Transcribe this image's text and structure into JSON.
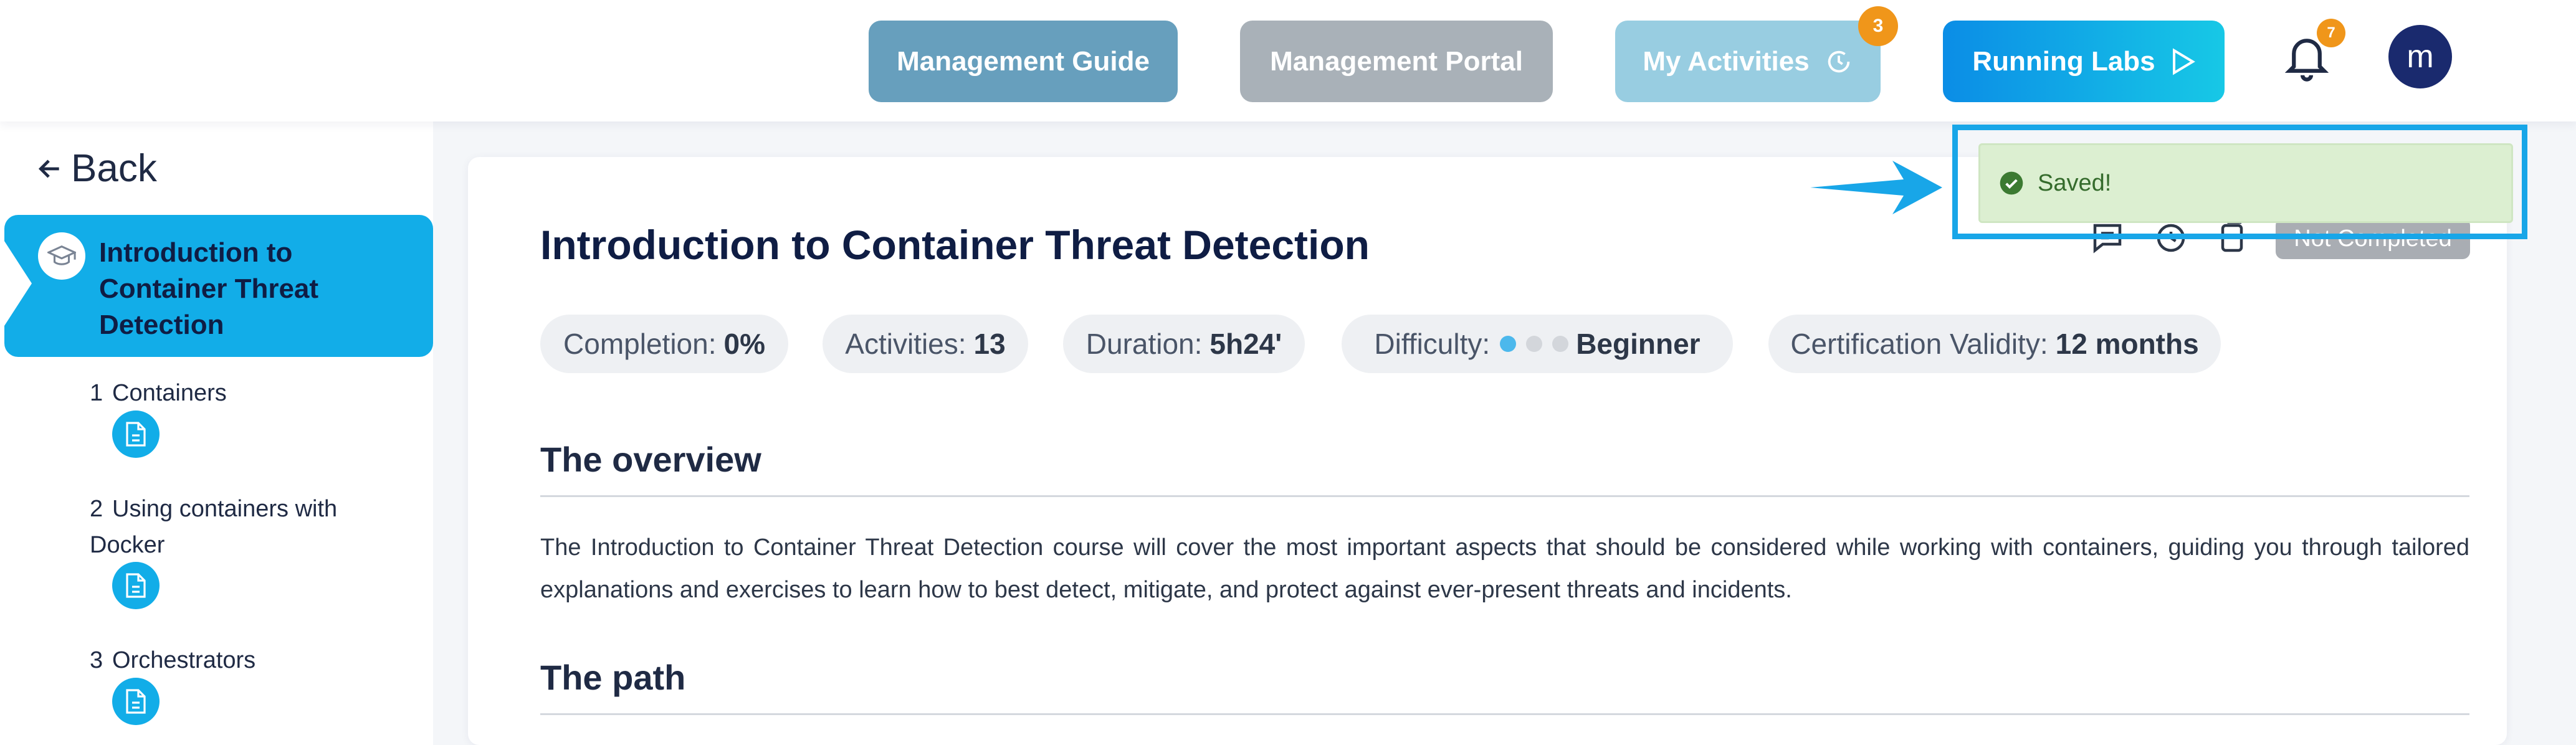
{
  "header": {
    "buttons": {
      "management_guide": "Management Guide",
      "management_portal": "Management Portal",
      "my_activities": "My Activities",
      "running_labs": "Running Labs"
    },
    "activities_badge": "3",
    "notifications_badge": "7",
    "avatar_initial": "m"
  },
  "sidebar": {
    "back_label": "Back",
    "active_course": "Introduction to Container Threat Detection",
    "lessons": [
      {
        "num": "1",
        "label": "Containers"
      },
      {
        "num": "2",
        "label": "Using containers with Docker"
      },
      {
        "num": "3",
        "label": "Orchestrators"
      }
    ]
  },
  "course": {
    "title": "Introduction to Container Threat Detection",
    "status": "Not Completed",
    "stats": {
      "completion_label": "Completion:",
      "completion_value": "0%",
      "activities_label": "Activities:",
      "activities_value": "13",
      "duration_label": "Duration:",
      "duration_value": "5h24'",
      "difficulty_label": "Difficulty:",
      "difficulty_value": "Beginner",
      "difficulty_level": 1,
      "difficulty_max": 3,
      "validity_label": "Certification Validity:",
      "validity_value": "12 months"
    },
    "overview_heading": "The overview",
    "overview_text": "The Introduction to Container Threat Detection course will cover the most important aspects that should be considered while working with containers, guiding you through tailored explanations and exercises to learn how to best detect, mitigate, and protect against ever-present threats and incidents.",
    "path_heading": "The path"
  },
  "toast": {
    "message": "Saved!"
  },
  "colors": {
    "accent": "#12ade8",
    "badge": "#f0961a",
    "toast_bg": "#dcefd1",
    "toast_text": "#356b2c",
    "difficulty_active": "#4cb8ec",
    "difficulty_inactive": "#d3d6db"
  },
  "icons": [
    "clock-icon",
    "bell-icon",
    "graduation-cap-icon",
    "document-icon",
    "check-circle-icon",
    "arrow-left-icon",
    "play-icon"
  ]
}
